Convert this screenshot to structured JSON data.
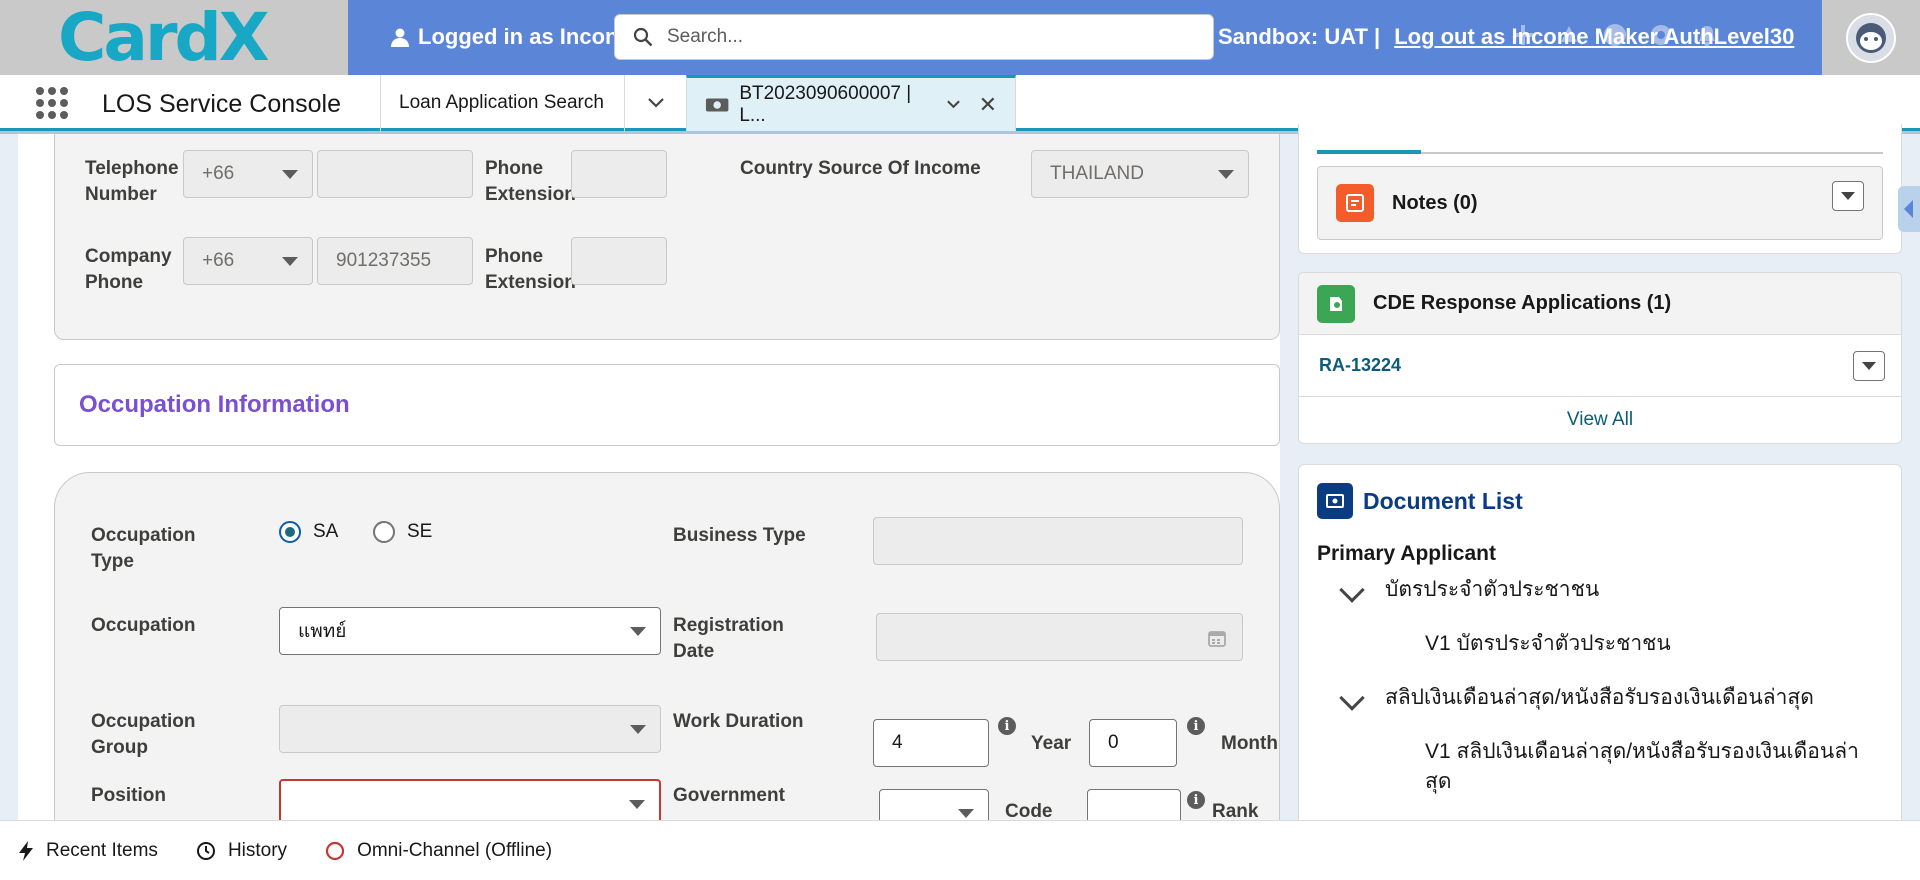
{
  "banner": {
    "logo_text": "CardX",
    "impersonation_left": "Logged in as Incon",
    "sandbox": "Sandbox: UAT |",
    "logout": "Log out as Income Maker AuthLevel30",
    "search_placeholder": "Search..."
  },
  "nav": {
    "app_name": "LOS Service Console",
    "tabs": [
      {
        "label": "Loan Application Search"
      },
      {
        "label": "BT2023090600007 | L..."
      }
    ]
  },
  "contact": {
    "telephone_label": "Telephone Number",
    "telephone_code": "+66",
    "telephone_number": "",
    "phone_ext_label": "Phone Extension",
    "country_source_label": "Country Source Of Income",
    "country_source_value": "THAILAND",
    "company_phone_label": "Company Phone",
    "company_phone_code": "+66",
    "company_phone_number": "901237355",
    "company_ext_label": "Phone Extension"
  },
  "occupation": {
    "section_title": "Occupation Information",
    "type_label": "Occupation Type",
    "type_options": [
      "SA",
      "SE"
    ],
    "type_selected": "SA",
    "business_type_label": "Business Type",
    "occupation_label": "Occupation",
    "occupation_value": "แพทย์",
    "registration_date_label": "Registration Date",
    "group_label": "Occupation Group",
    "work_duration_label": "Work Duration",
    "work_years": "4",
    "year_label": "Year",
    "work_months": "0",
    "month_label": "Month",
    "position_label": "Position",
    "government_label": "Government",
    "code_label": "Code",
    "rank_label": "Rank"
  },
  "side": {
    "notes_title": "Notes (0)",
    "cde_title": "CDE Response Applications (1)",
    "cde_item": "RA-13224",
    "view_all": "View All",
    "doc_title": "Document List",
    "primary_applicant": "Primary Applicant",
    "doc_groups": [
      {
        "name": "บัตรประจำตัวประชาชน",
        "item": "V1 บัตรประจำตัวประชาชน"
      },
      {
        "name": "สลิปเงินเดือนล่าสุด/หนังสือรับรองเงินเดือนล่าสุด",
        "item_line1": "V1 สลิปเงินเดือนล่าสุด/หนังสือรับรองเงินเดือนล่า",
        "item_line2": "สุด"
      }
    ]
  },
  "utility": {
    "recent_items": "Recent Items",
    "history": "History",
    "omni": "Omni-Channel (Offline)"
  },
  "colors": {
    "brand_blue": "#5b86d8",
    "accent_teal": "#1b96b5",
    "section_purple": "#7a4fd1",
    "error_red": "#c23934"
  }
}
